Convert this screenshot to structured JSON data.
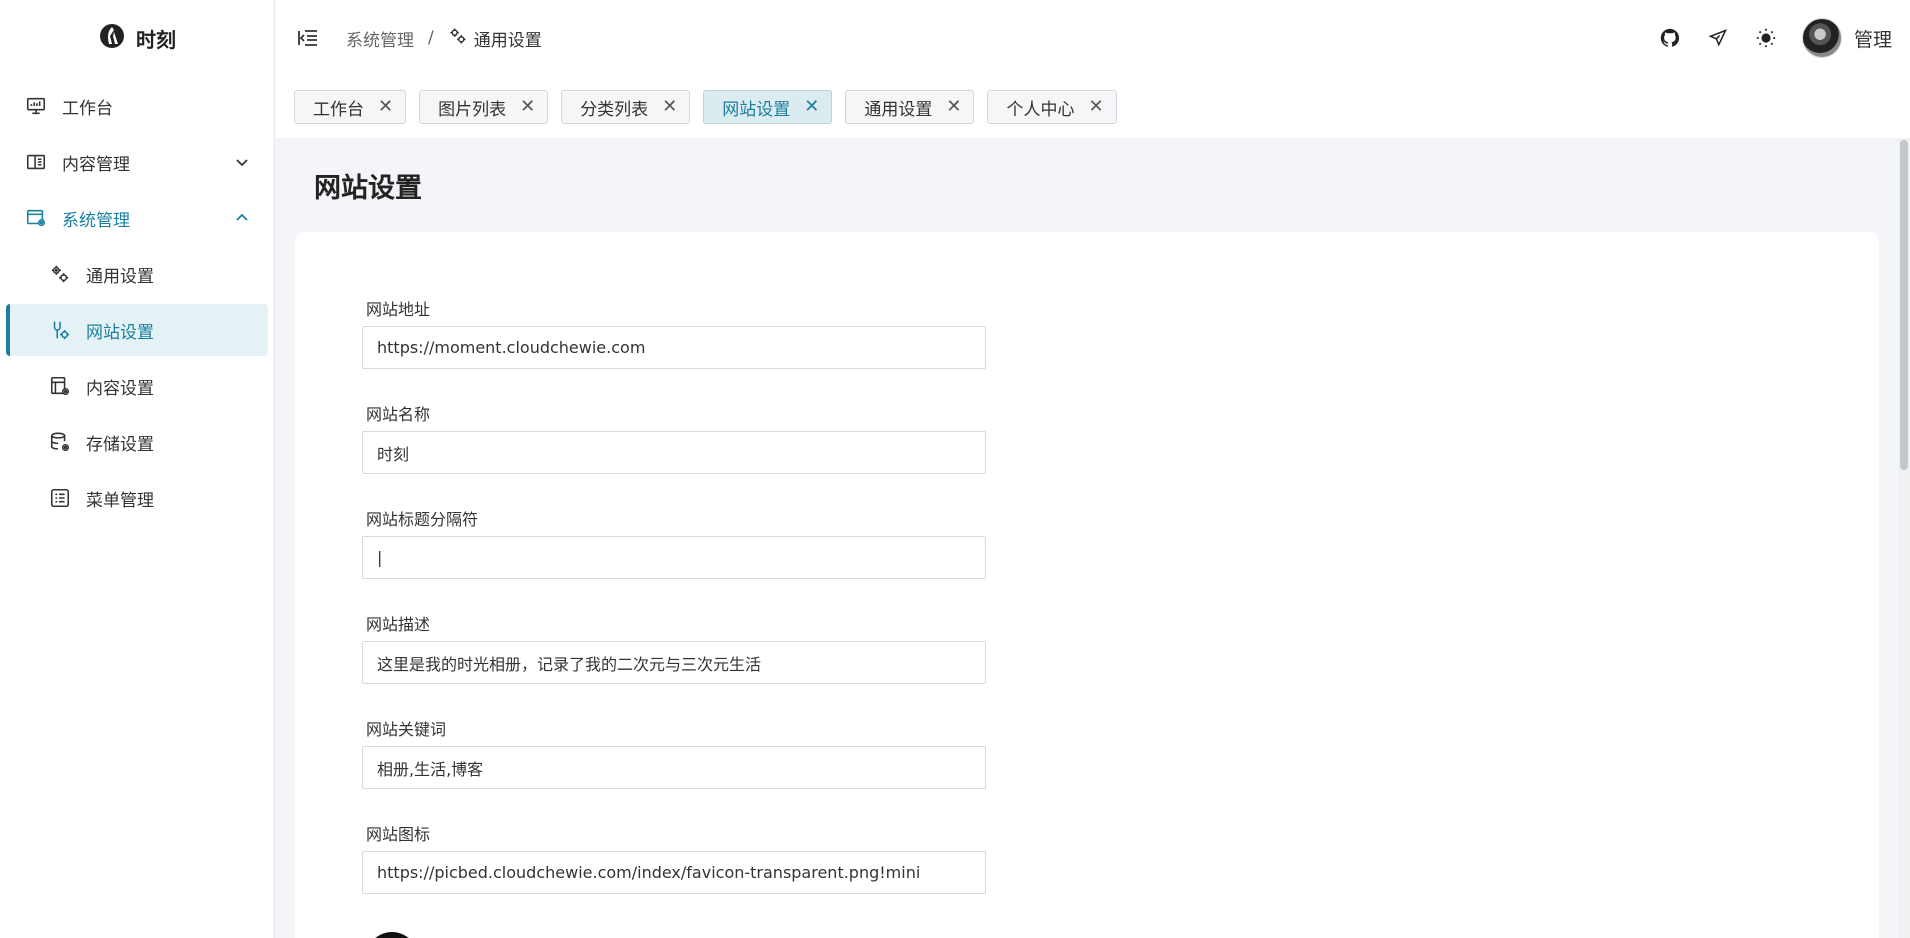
{
  "brand": {
    "name": "时刻"
  },
  "sidebar": {
    "items": [
      {
        "label": "工作台"
      },
      {
        "label": "内容管理"
      },
      {
        "label": "系统管理"
      },
      {
        "label": "通用设置"
      },
      {
        "label": "网站设置"
      },
      {
        "label": "内容设置"
      },
      {
        "label": "存储设置"
      },
      {
        "label": "菜单管理"
      }
    ]
  },
  "header": {
    "breadcrumb": {
      "parent": "系统管理",
      "separator": "/",
      "current": "通用设置"
    },
    "user_name": "管理"
  },
  "tabs": [
    {
      "label": "工作台"
    },
    {
      "label": "图片列表"
    },
    {
      "label": "分类列表"
    },
    {
      "label": "网站设置"
    },
    {
      "label": "通用设置"
    },
    {
      "label": "个人中心"
    }
  ],
  "tab_close_glyph": "✕",
  "page": {
    "title": "网站设置"
  },
  "form": {
    "site_url": {
      "label": "网站地址",
      "value": "https://moment.cloudchewie.com"
    },
    "site_name": {
      "label": "网站名称",
      "value": "时刻"
    },
    "title_separator": {
      "label": "网站标题分隔符",
      "value": "|"
    },
    "site_description": {
      "label": "网站描述",
      "value": "这里是我的时光相册，记录了我的二次元与三次元生活"
    },
    "site_keywords": {
      "label": "网站关键词",
      "value": "相册,生活,博客"
    },
    "site_icon": {
      "label": "网站图标",
      "value": "https://picbed.cloudchewie.com/index/favicon-transparent.png!mini"
    }
  },
  "colors": {
    "accent": "#1a7fa0",
    "active_bg": "#e4f1f5"
  }
}
